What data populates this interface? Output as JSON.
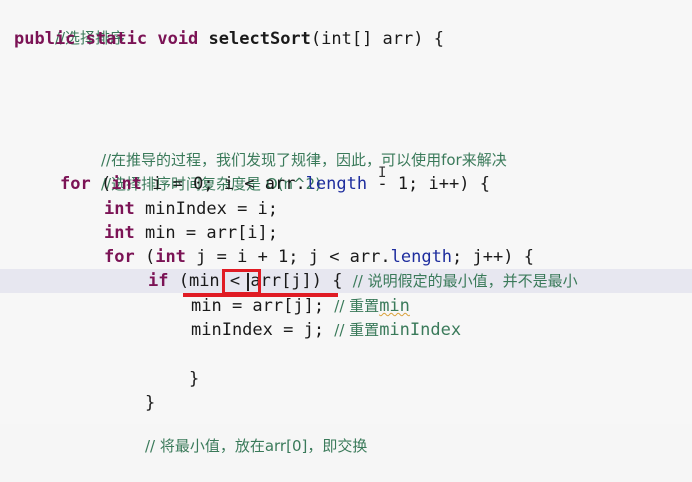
{
  "code": {
    "line1_comment": "//选择排序",
    "line2": {
      "kw1": "public",
      "kw2": "static",
      "kw3": "void",
      "method": "selectSort",
      "rest": "(int[] arr) {"
    },
    "line3_comment": "//在推导的过程，我们发现了规律，因此，可以使用for来解决",
    "line4_comment": "//选择排序时间复杂度是 O(n^2)",
    "line5": {
      "kw": "for",
      "a": " (",
      "kw2": "int",
      "b": " i = 0; i < arr.",
      "field": "length",
      "c": " - 1; i++) {"
    },
    "line6": {
      "kw": "int",
      "rest": " minIndex = i;"
    },
    "line7": {
      "kw": "int",
      "rest": " min = arr[i];"
    },
    "line8": {
      "kw": "for",
      "a": " (",
      "kw2": "int",
      "b": " j = i + 1; j < arr.",
      "field": "length",
      "c": "; j++) {"
    },
    "line9": {
      "kw": "if",
      "code": " (min < arr[j]) { ",
      "comment": "// 说明假定的最小值，并不是最小"
    },
    "line10": {
      "code": "min = arr[j]; ",
      "comment_prefix": "// 重置",
      "comment_var": "min"
    },
    "line11": {
      "code": "minIndex = j; ",
      "comment_prefix": "// 重置",
      "comment_var": "minIndex"
    },
    "line12": "}",
    "line13": "}",
    "line14_comment": "// 将最小值，放在arr[0]，即交换"
  },
  "cursor_icon": "text-cursor-icon"
}
